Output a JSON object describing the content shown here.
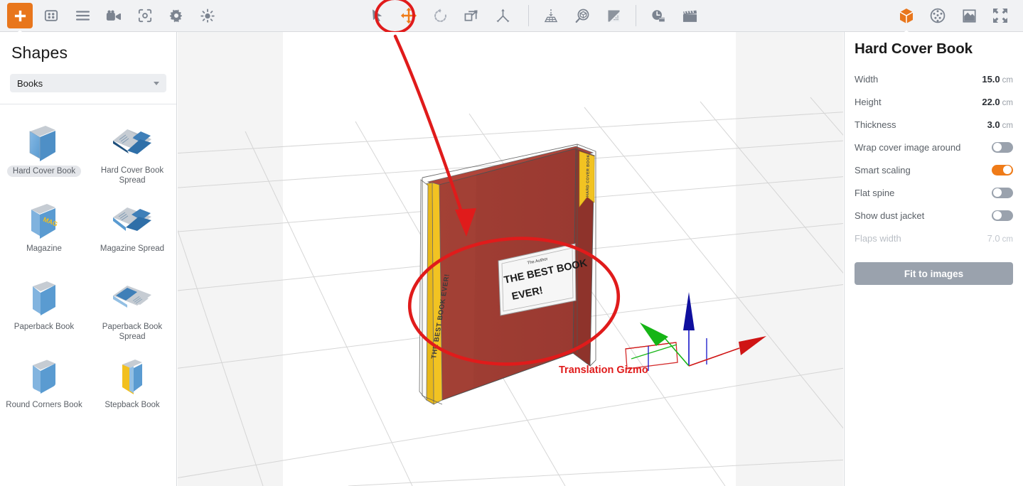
{
  "toolbar": {
    "left_tools": [
      {
        "name": "add-shape-icon",
        "label": "Add Shape",
        "state": "active"
      },
      {
        "name": "grid-layout-icon",
        "label": "Layouts"
      },
      {
        "name": "menu-lines-icon",
        "label": "Properties"
      },
      {
        "name": "camera-video-icon",
        "label": "Camera"
      },
      {
        "name": "focus-frame-icon",
        "label": "Focus"
      },
      {
        "name": "gear-icon",
        "label": "Settings"
      },
      {
        "name": "brightness-icon",
        "label": "Lighting"
      }
    ],
    "transform_tools": [
      {
        "name": "cursor-arrow-icon",
        "label": "Select"
      },
      {
        "name": "move-translate-icon",
        "label": "Translate",
        "state": "selected"
      },
      {
        "name": "rotate-icon",
        "label": "Rotate"
      },
      {
        "name": "scale-icon",
        "label": "Scale"
      },
      {
        "name": "distribute-icon",
        "label": "Distribute"
      }
    ],
    "scene_tools": [
      {
        "name": "drop-to-floor-icon",
        "label": "Drop to floor"
      },
      {
        "name": "magnify-object-icon",
        "label": "Zoom to object"
      },
      {
        "name": "shadow-icon",
        "label": "Shadow"
      }
    ],
    "render_tools": [
      {
        "name": "render-time-icon",
        "label": "Render queue"
      },
      {
        "name": "animation-clapper-icon",
        "label": "Animation"
      }
    ],
    "right_tools": [
      {
        "name": "cube-3d-icon",
        "label": "3D View",
        "state": "active"
      },
      {
        "name": "material-sphere-icon",
        "label": "Materials"
      },
      {
        "name": "image-mask-icon",
        "label": "Image"
      },
      {
        "name": "fullscreen-icon",
        "label": "Fullscreen"
      }
    ]
  },
  "sidebar": {
    "title": "Shapes",
    "category_select": {
      "value": "Books",
      "options": [
        "Books"
      ]
    },
    "shapes": [
      {
        "label": "Hard Cover Book",
        "icon": "hard-cover-book-icon",
        "selected": true
      },
      {
        "label": "Hard Cover Book Spread",
        "icon": "hard-cover-book-spread-icon",
        "selected": false
      },
      {
        "label": "Magazine",
        "icon": "magazine-icon",
        "selected": false
      },
      {
        "label": "Magazine Spread",
        "icon": "magazine-spread-icon",
        "selected": false
      },
      {
        "label": "Paperback Book",
        "icon": "paperback-book-icon",
        "selected": false
      },
      {
        "label": "Paperback Book Spread",
        "icon": "paperback-book-spread-icon",
        "selected": false
      },
      {
        "label": "Round Corners Book",
        "icon": "round-corners-book-icon",
        "selected": false
      },
      {
        "label": "Stepback Book",
        "icon": "stepback-book-icon",
        "selected": false
      }
    ]
  },
  "viewport": {
    "annotation_label": "Translation Gizmo",
    "annotation_color": "#e01b1b",
    "book": {
      "cover_title": "THE BEST BOOK EVER!",
      "cover_title_line1": "THE BEST BOOK",
      "cover_title_line2": "EVER!",
      "author": "The Author",
      "spine_text": "THE BEST BOOK EVER!",
      "bookmark_text": "HARD COVER BOOK",
      "cover_color": "#9e3b32",
      "spine_color": "#f2c322",
      "pages_color": "#f4f4f0"
    },
    "gizmo": {
      "x_axis_color": "#e01b1b",
      "y_axis_color": "#1414c8",
      "z_axis_color": "#16b516"
    }
  },
  "properties": {
    "title": "Hard Cover Book",
    "rows": [
      {
        "label": "Width",
        "value": "15.0",
        "unit": "cm",
        "type": "number",
        "disabled": false
      },
      {
        "label": "Height",
        "value": "22.0",
        "unit": "cm",
        "type": "number",
        "disabled": false
      },
      {
        "label": "Thickness",
        "value": "3.0",
        "unit": "cm",
        "type": "number",
        "disabled": false
      },
      {
        "label": "Wrap cover image around",
        "value": "",
        "unit": "",
        "type": "toggle",
        "on": false,
        "disabled": false
      },
      {
        "label": "Smart scaling",
        "value": "",
        "unit": "",
        "type": "toggle",
        "on": true,
        "disabled": false
      },
      {
        "label": "Flat spine",
        "value": "",
        "unit": "",
        "type": "toggle",
        "on": false,
        "disabled": false
      },
      {
        "label": "Show dust jacket",
        "value": "",
        "unit": "",
        "type": "toggle",
        "on": false,
        "disabled": false
      },
      {
        "label": "Flaps width",
        "value": "7.0",
        "unit": "cm",
        "type": "number",
        "disabled": true
      }
    ],
    "fit_button_label": "Fit to images",
    "accent_color": "#ef7b18"
  }
}
